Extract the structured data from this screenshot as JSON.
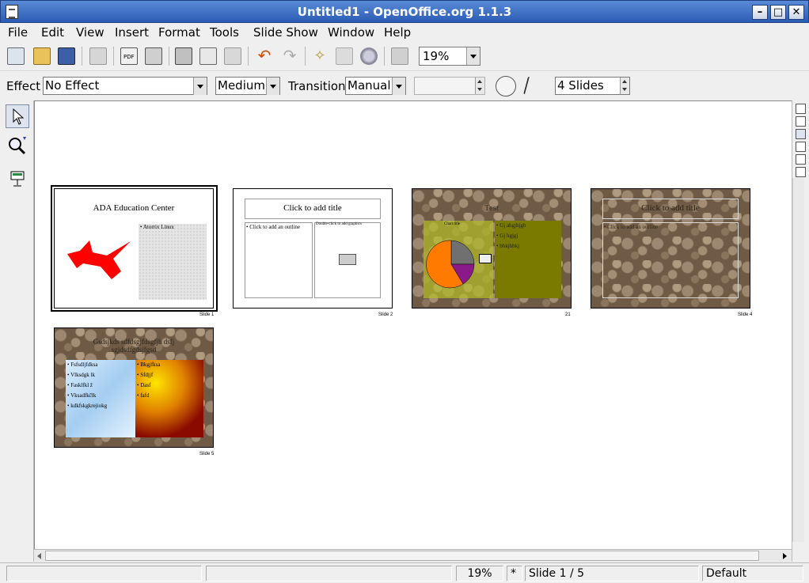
{
  "window": {
    "title": "Untitled1 - OpenOffice.org 1.1.3"
  },
  "menu": [
    "File",
    "Edit",
    "View",
    "Insert",
    "Format",
    "Tools",
    "Slide Show",
    "Window",
    "Help"
  ],
  "toolbar": {
    "zoom_value": "19%"
  },
  "effectbar": {
    "effect_label": "Effect",
    "effect_value": "No Effect",
    "speed_value": "Medium",
    "transition_label": "Transition",
    "transition_value": "Manual",
    "time_value": "",
    "slides_value": "4 Slides"
  },
  "slides": [
    {
      "title": "ADA Education Center",
      "bullets": [
        "Atorrix Linux"
      ],
      "label": "Slide 1"
    },
    {
      "title": "Click to add title",
      "outline": "Click to add an outline",
      "graphic_hint": "Double-click to add graphics",
      "label": "Slide 2"
    },
    {
      "title": "Test",
      "chart_title": "Chart title",
      "bullets": [
        "Gj ahgjhjgh",
        "Gj hgjgj",
        "bhkjhbkj"
      ],
      "label": "21"
    },
    {
      "title": "Click to add title",
      "outline": "Click to add an outline",
      "label": "Slide 4"
    },
    {
      "title": "Gsdsjkds sdfdsgjfdsgfjh dsfj sgjdsdfgdsjfgsd",
      "bullets_left": [
        "Fsfsdljfdksa",
        "Vlksdgk lk",
        "Fasklfkl ž",
        "Vksadfkčlk",
        "kdkfskgkrejiokg"
      ],
      "bullets_right": [
        "Bkgjfksa",
        "Sfdjjf",
        "Dasf",
        "fafd"
      ],
      "label": "Slide 5"
    }
  ],
  "status": {
    "zoom": "19%",
    "modified": "*",
    "slide": "Slide 1 / 5",
    "layout": "Default"
  }
}
